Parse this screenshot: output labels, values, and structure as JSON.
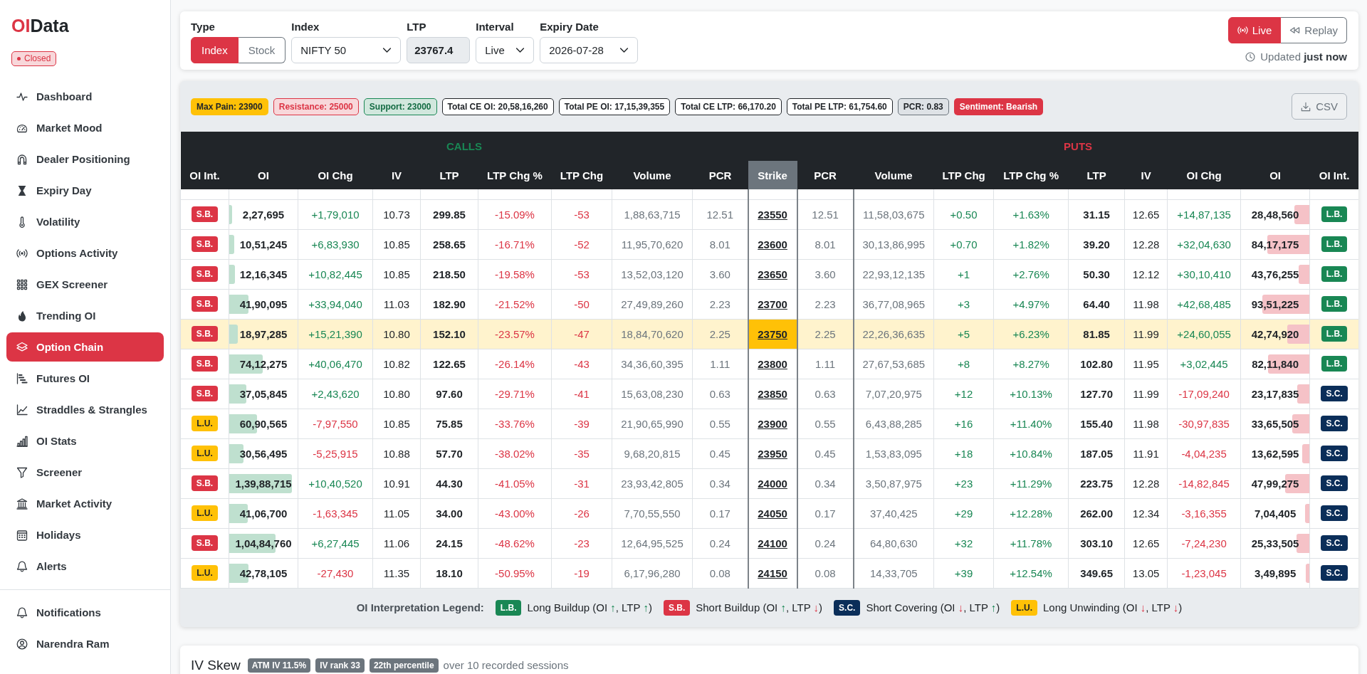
{
  "sidebar": {
    "logo": [
      "OI",
      "Data"
    ],
    "market_status": "Closed",
    "items": [
      {
        "label": "Dashboard",
        "selected": false
      },
      {
        "label": "Market Mood",
        "selected": false
      },
      {
        "label": "Dealer Positioning",
        "selected": false
      },
      {
        "label": "Expiry Day",
        "selected": false
      },
      {
        "label": "Volatility",
        "selected": false
      },
      {
        "label": "Options Activity",
        "selected": false
      },
      {
        "label": "GEX Screener",
        "selected": false
      },
      {
        "label": "Trending OI",
        "selected": false
      },
      {
        "label": "Option Chain",
        "selected": true
      },
      {
        "label": "Futures OI",
        "selected": false
      },
      {
        "label": "Straddles & Strangles",
        "selected": false
      },
      {
        "label": "OI Stats",
        "selected": false
      },
      {
        "label": "Screener",
        "selected": false
      },
      {
        "label": "Market Activity",
        "selected": false
      },
      {
        "label": "Holidays",
        "selected": false
      },
      {
        "label": "Alerts",
        "selected": false
      }
    ],
    "footer_items": [
      {
        "label": "Notifications"
      },
      {
        "label": "Narendra Ram"
      }
    ]
  },
  "filters": {
    "type": {
      "label": "Type",
      "options": [
        {
          "label": "Index",
          "selected": true
        },
        {
          "label": "Stock",
          "selected": false
        }
      ]
    },
    "index": {
      "label": "Index",
      "value": "NIFTY 50"
    },
    "ltp": {
      "label": "LTP",
      "value": "23767.4"
    },
    "interval": {
      "label": "Interval",
      "value": "Live"
    },
    "expiry": {
      "label": "Expiry Date",
      "value": "2026-07-28"
    }
  },
  "mode": {
    "options": [
      {
        "label": "Live",
        "selected": true
      },
      {
        "label": "Replay",
        "selected": false
      }
    ],
    "updated": "Updated **just now**"
  },
  "summary": {
    "chips": [
      {
        "text": "Max Pain: 23900",
        "kind": "warning"
      },
      {
        "text": "Resistance: 25000",
        "kind": "danger_soft"
      },
      {
        "text": "Support: 23000",
        "kind": "success_soft"
      },
      {
        "text": "Total CE OI: 20,58,16,260",
        "kind": "outline"
      },
      {
        "text": "Total PE OI: 17,15,39,355",
        "kind": "outline"
      },
      {
        "text": "Total CE LTP: 66,170.20",
        "kind": "outline"
      },
      {
        "text": "Total PE LTP: 61,754.60",
        "kind": "outline"
      },
      {
        "text": "PCR: 0.83",
        "kind": "secondary"
      },
      {
        "text": "Sentiment: Bearish",
        "kind": "danger"
      }
    ],
    "export_button": "CSV"
  },
  "option_chain": {
    "groups": {
      "calls": "CALLS",
      "puts": "PUTS"
    },
    "columns": {
      "calls": [
        "OI Int.",
        "OI",
        "OI Chg",
        "IV",
        "LTP",
        "LTP Chg %",
        "LTP Chg",
        "Volume",
        "PCR"
      ],
      "strike": "Strike",
      "puts": [
        "PCR",
        "Volume",
        "LTP Chg",
        "LTP Chg %",
        "LTP",
        "IV",
        "OI Chg",
        "OI",
        "OI Int."
      ]
    },
    "rows": [
      {
        "strike": "23550",
        "atm": false,
        "call": {
          "oi_int": "S.B.",
          "oi": {
            "value": "2,27,695",
            "level": 0.04
          },
          "oi_chg": "+1,79,010",
          "oi_up": true,
          "iv": "10.73",
          "ltp": "299.85",
          "ltp_chg_pct": "-15.09%",
          "ltp_chg": "-53",
          "ltp_up": false,
          "volume": "1,88,63,715",
          "pcr": "12.51"
        },
        "put": {
          "pcr": "12.51",
          "volume": "11,58,03,675",
          "ltp_chg": "+0.50",
          "ltp_chg_pct": "+1.63%",
          "ltp_up": true,
          "ltp": "31.15",
          "iv": "12.65",
          "oi_chg": "+14,87,135",
          "oi_up": true,
          "oi": {
            "value": "28,48,560",
            "level": 0.22
          },
          "oi_int": "L.B."
        }
      },
      {
        "strike": "23600",
        "atm": false,
        "call": {
          "oi_int": "S.B.",
          "oi": {
            "value": "10,51,245",
            "level": 0.07
          },
          "oi_chg": "+6,83,930",
          "oi_up": true,
          "iv": "10.85",
          "ltp": "258.65",
          "ltp_chg_pct": "-16.71%",
          "ltp_chg": "-52",
          "ltp_up": false,
          "volume": "11,95,70,620",
          "pcr": "8.01"
        },
        "put": {
          "pcr": "8.01",
          "volume": "30,13,86,995",
          "ltp_chg": "+0.70",
          "ltp_chg_pct": "+1.82%",
          "ltp_up": true,
          "ltp": "39.20",
          "iv": "12.28",
          "oi_chg": "+32,04,630",
          "oi_up": true,
          "oi": {
            "value": "84,17,175",
            "level": 0.62
          },
          "oi_int": "L.B."
        }
      },
      {
        "strike": "23650",
        "atm": false,
        "call": {
          "oi_int": "S.B.",
          "oi": {
            "value": "12,16,345",
            "level": 0.08
          },
          "oi_chg": "+10,82,445",
          "oi_up": true,
          "iv": "10.85",
          "ltp": "218.50",
          "ltp_chg_pct": "-19.58%",
          "ltp_chg": "-53",
          "ltp_up": false,
          "volume": "13,52,03,120",
          "pcr": "3.60"
        },
        "put": {
          "pcr": "3.60",
          "volume": "22,93,12,135",
          "ltp_chg": "+1",
          "ltp_chg_pct": "+2.76%",
          "ltp_up": true,
          "ltp": "50.30",
          "iv": "12.12",
          "oi_chg": "+30,10,410",
          "oi_up": true,
          "oi": {
            "value": "43,76,255",
            "level": 0.16
          },
          "oi_int": "L.B."
        }
      },
      {
        "strike": "23700",
        "atm": false,
        "call": {
          "oi_int": "S.B.",
          "oi": {
            "value": "41,90,095",
            "level": 0.28
          },
          "oi_chg": "+33,94,040",
          "oi_up": true,
          "iv": "11.03",
          "ltp": "182.90",
          "ltp_chg_pct": "-21.52%",
          "ltp_chg": "-50",
          "ltp_up": false,
          "volume": "27,49,89,260",
          "pcr": "2.23"
        },
        "put": {
          "pcr": "2.23",
          "volume": "36,77,08,965",
          "ltp_chg": "+3",
          "ltp_chg_pct": "+4.97%",
          "ltp_up": true,
          "ltp": "64.40",
          "iv": "11.98",
          "oi_chg": "+42,68,485",
          "oi_up": true,
          "oi": {
            "value": "93,51,225",
            "level": 0.69
          },
          "oi_int": "L.B."
        }
      },
      {
        "strike": "23750",
        "atm": true,
        "call": {
          "oi_int": "S.B.",
          "oi": {
            "value": "18,97,285",
            "level": 0.13
          },
          "oi_chg": "+15,21,390",
          "oi_up": true,
          "iv": "10.80",
          "ltp": "152.10",
          "ltp_chg_pct": "-23.57%",
          "ltp_chg": "-47",
          "ltp_up": false,
          "volume": "18,84,70,620",
          "pcr": "2.25"
        },
        "put": {
          "pcr": "2.25",
          "volume": "22,26,36,635",
          "ltp_chg": "+5",
          "ltp_chg_pct": "+6.23%",
          "ltp_up": true,
          "ltp": "81.85",
          "iv": "11.99",
          "oi_chg": "+24,60,055",
          "oi_up": true,
          "oi": {
            "value": "42,74,920",
            "level": 0.32
          },
          "oi_int": "L.B."
        }
      },
      {
        "strike": "23800",
        "atm": false,
        "call": {
          "oi_int": "S.B.",
          "oi": {
            "value": "74,12,275",
            "level": 0.49
          },
          "oi_chg": "+40,06,470",
          "oi_up": true,
          "iv": "10.82",
          "ltp": "122.65",
          "ltp_chg_pct": "-26.14%",
          "ltp_chg": "-43",
          "ltp_up": false,
          "volume": "34,36,60,395",
          "pcr": "1.11"
        },
        "put": {
          "pcr": "1.11",
          "volume": "27,67,53,685",
          "ltp_chg": "+8",
          "ltp_chg_pct": "+8.27%",
          "ltp_up": true,
          "ltp": "102.80",
          "iv": "11.95",
          "oi_chg": "+3,02,445",
          "oi_up": true,
          "oi": {
            "value": "82,11,840",
            "level": 0.61
          },
          "oi_int": "L.B."
        }
      },
      {
        "strike": "23850",
        "atm": false,
        "call": {
          "oi_int": "S.B.",
          "oi": {
            "value": "37,05,845",
            "level": 0.25
          },
          "oi_chg": "+2,43,620",
          "oi_up": true,
          "iv": "10.80",
          "ltp": "97.60",
          "ltp_chg_pct": "-29.71%",
          "ltp_chg": "-41",
          "ltp_up": false,
          "volume": "15,63,08,230",
          "pcr": "0.63"
        },
        "put": {
          "pcr": "0.63",
          "volume": "7,07,20,975",
          "ltp_chg": "+12",
          "ltp_chg_pct": "+10.13%",
          "ltp_up": true,
          "ltp": "127.70",
          "iv": "11.99",
          "oi_chg": "-17,09,240",
          "oi_up": false,
          "oi": {
            "value": "23,17,835",
            "level": 0.18
          },
          "oi_int": "S.C."
        }
      },
      {
        "strike": "23900",
        "atm": false,
        "call": {
          "oi_int": "L.U.",
          "oi": {
            "value": "60,90,565",
            "level": 0.41
          },
          "oi_chg": "-7,97,550",
          "oi_up": false,
          "iv": "10.85",
          "ltp": "75.85",
          "ltp_chg_pct": "-33.76%",
          "ltp_chg": "-39",
          "ltp_up": false,
          "volume": "21,90,65,990",
          "pcr": "0.55"
        },
        "put": {
          "pcr": "0.55",
          "volume": "6,43,88,285",
          "ltp_chg": "+16",
          "ltp_chg_pct": "+11.40%",
          "ltp_up": true,
          "ltp": "155.40",
          "iv": "11.98",
          "oi_chg": "-30,97,835",
          "oi_up": false,
          "oi": {
            "value": "33,65,505",
            "level": 0.25
          },
          "oi_int": "S.C."
        }
      },
      {
        "strike": "23950",
        "atm": false,
        "call": {
          "oi_int": "L.U.",
          "oi": {
            "value": "30,56,495",
            "level": 0.21
          },
          "oi_chg": "-5,25,915",
          "oi_up": false,
          "iv": "10.88",
          "ltp": "57.70",
          "ltp_chg_pct": "-38.02%",
          "ltp_chg": "-35",
          "ltp_up": false,
          "volume": "9,68,20,815",
          "pcr": "0.45"
        },
        "put": {
          "pcr": "0.45",
          "volume": "1,53,83,095",
          "ltp_chg": "+18",
          "ltp_chg_pct": "+10.84%",
          "ltp_up": true,
          "ltp": "187.05",
          "iv": "11.91",
          "oi_chg": "-4,04,235",
          "oi_up": false,
          "oi": {
            "value": "13,62,595",
            "level": 0.1
          },
          "oi_int": "S.C."
        }
      },
      {
        "strike": "24000",
        "atm": false,
        "call": {
          "oi_int": "S.B.",
          "oi": {
            "value": "1,39,88,715",
            "level": 0.92
          },
          "oi_chg": "+10,40,520",
          "oi_up": true,
          "iv": "10.91",
          "ltp": "44.30",
          "ltp_chg_pct": "-41.05%",
          "ltp_chg": "-31",
          "ltp_up": false,
          "volume": "23,93,42,805",
          "pcr": "0.34"
        },
        "put": {
          "pcr": "0.34",
          "volume": "3,50,87,975",
          "ltp_chg": "+23",
          "ltp_chg_pct": "+11.29%",
          "ltp_up": true,
          "ltp": "223.75",
          "iv": "12.28",
          "oi_chg": "-14,82,845",
          "oi_up": false,
          "oi": {
            "value": "47,99,275",
            "level": 0.35
          },
          "oi_int": "S.C."
        }
      },
      {
        "strike": "24050",
        "atm": false,
        "call": {
          "oi_int": "L.U.",
          "oi": {
            "value": "41,06,700",
            "level": 0.27
          },
          "oi_chg": "-1,63,345",
          "oi_up": false,
          "iv": "11.05",
          "ltp": "34.00",
          "ltp_chg_pct": "-43.00%",
          "ltp_chg": "-26",
          "ltp_up": false,
          "volume": "7,70,55,550",
          "pcr": "0.17"
        },
        "put": {
          "pcr": "0.17",
          "volume": "37,40,425",
          "ltp_chg": "+29",
          "ltp_chg_pct": "+12.28%",
          "ltp_up": true,
          "ltp": "262.00",
          "iv": "12.34",
          "oi_chg": "-3,16,355",
          "oi_up": false,
          "oi": {
            "value": "7,04,405",
            "level": 0.06
          },
          "oi_int": "S.C."
        }
      },
      {
        "strike": "24100",
        "atm": false,
        "call": {
          "oi_int": "S.B.",
          "oi": {
            "value": "1,04,84,760",
            "level": 0.68
          },
          "oi_chg": "+6,27,445",
          "oi_up": true,
          "iv": "11.06",
          "ltp": "24.15",
          "ltp_chg_pct": "-48.62%",
          "ltp_chg": "-23",
          "ltp_up": false,
          "volume": "12,64,95,525",
          "pcr": "0.24"
        },
        "put": {
          "pcr": "0.24",
          "volume": "64,80,630",
          "ltp_chg": "+32",
          "ltp_chg_pct": "+11.78%",
          "ltp_up": true,
          "ltp": "303.10",
          "iv": "12.65",
          "oi_chg": "-7,24,230",
          "oi_up": false,
          "oi": {
            "value": "25,33,505",
            "level": 0.19
          },
          "oi_int": "S.C."
        }
      },
      {
        "strike": "24150",
        "atm": false,
        "call": {
          "oi_int": "L.U.",
          "oi": {
            "value": "42,78,105",
            "level": 0.28
          },
          "oi_chg": "-27,430",
          "oi_up": false,
          "iv": "11.35",
          "ltp": "18.10",
          "ltp_chg_pct": "-50.95%",
          "ltp_chg": "-19",
          "ltp_up": false,
          "volume": "6,17,96,280",
          "pcr": "0.08"
        },
        "put": {
          "pcr": "0.08",
          "volume": "14,33,705",
          "ltp_chg": "+39",
          "ltp_chg_pct": "+12.54%",
          "ltp_up": true,
          "ltp": "349.65",
          "iv": "13.05",
          "oi_chg": "-1,23,045",
          "oi_up": false,
          "oi": {
            "value": "3,49,895",
            "level": 0.05
          },
          "oi_int": "S.C."
        }
      }
    ]
  },
  "legend": {
    "title": "OI Interpretation Legend:",
    "items": [
      {
        "badge": "L.B.",
        "oi_up": true,
        "ltp_up": true,
        "text": [
          "Long Buildup (OI ",
          "↑",
          ", LTP ",
          "↑",
          ")"
        ]
      },
      {
        "badge": "S.B.",
        "oi_up": true,
        "ltp_up": false,
        "text": [
          "Short Buildup (OI ",
          "↑",
          ", LTP ",
          "↓",
          ")"
        ]
      },
      {
        "badge": "S.C.",
        "oi_up": false,
        "ltp_up": true,
        "text": [
          "Short Covering (OI ",
          "↓",
          ", LTP ",
          "↑",
          ")"
        ]
      },
      {
        "badge": "L.U.",
        "oi_up": false,
        "ltp_up": false,
        "text": [
          "Long Unwinding (OI ",
          "↓",
          ", LTP ",
          "↓",
          ")"
        ]
      }
    ]
  },
  "iv_skew": {
    "title": "IV Skew",
    "badges": [
      "ATM IV 11.5%",
      "IV rank 33",
      "22th percentile"
    ],
    "note": "over 10 recorded sessions"
  }
}
